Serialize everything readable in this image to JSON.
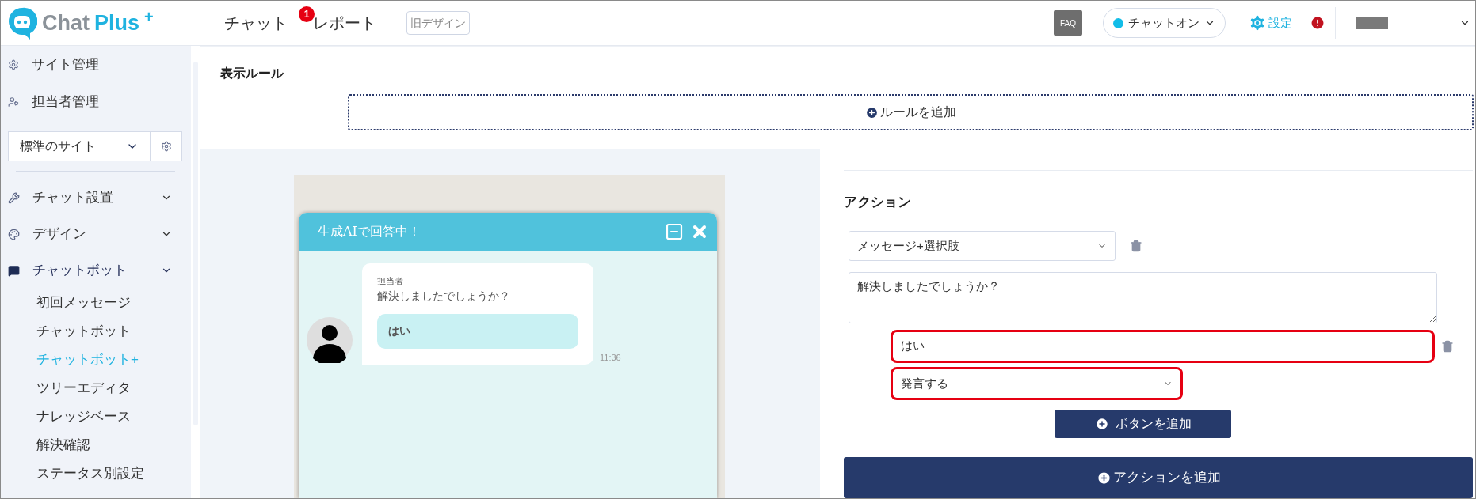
{
  "header": {
    "logo_text": "Chat",
    "logo_accent": "Plus",
    "logo_mark": "+",
    "nav": [
      {
        "label": "チャット",
        "badge": "1"
      },
      {
        "label": "レポート"
      }
    ],
    "old_design_button": "旧デザイン",
    "faq": "FAQ",
    "status_toggle": {
      "label": "チャットオン",
      "on": true
    },
    "settings": "設定"
  },
  "sidebar": {
    "top_items": [
      {
        "label": "サイト管理"
      },
      {
        "label": "担当者管理"
      }
    ],
    "site_select": "標準のサイト",
    "sections": [
      {
        "label": "チャット設置",
        "expanded": false
      },
      {
        "label": "デザイン",
        "expanded": false
      },
      {
        "label": "チャットボット",
        "expanded": true,
        "children": [
          {
            "label": "初回メッセージ",
            "selected": false
          },
          {
            "label": "チャットボット",
            "selected": false
          },
          {
            "label": "チャットボット+",
            "selected": true
          },
          {
            "label": "ツリーエディタ",
            "selected": false
          },
          {
            "label": "ナレッジベース",
            "selected": false
          },
          {
            "label": "解決確認",
            "selected": false
          },
          {
            "label": "ステータス別設定",
            "selected": false
          }
        ]
      }
    ]
  },
  "display_rule": {
    "title": "表示ルール",
    "add_button": "ルールを追加"
  },
  "preview": {
    "chat_title": "生成AIで回答中！",
    "operator": "担当者",
    "message": "解決しましたでしょうか？",
    "choice": "はい",
    "time": "11:36"
  },
  "action": {
    "title": "アクション",
    "type_select": "メッセージ+選択肢",
    "message": "解決しましたでしょうか？",
    "choices": [
      {
        "label": "はい",
        "behavior": "発言する",
        "label_highlighted": true,
        "behavior_highlighted": true
      }
    ],
    "add_choice_button": "ボタンを追加",
    "add_action_button": "アクションを追加"
  }
}
